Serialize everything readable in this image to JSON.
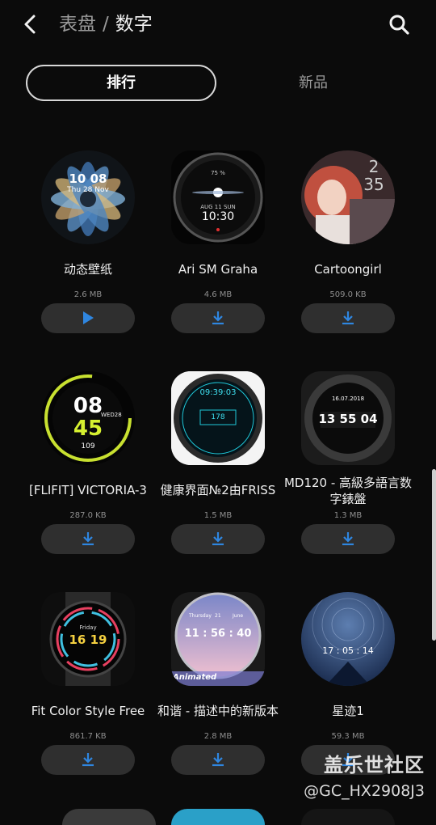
{
  "header": {
    "crumb": "表盘",
    "separator": "/",
    "current": "数字"
  },
  "tabs": [
    {
      "label": "排行",
      "active": true
    },
    {
      "label": "新品",
      "active": false
    }
  ],
  "cards": [
    {
      "name": "动态壁纸",
      "size": "2.6 MB",
      "action": "play",
      "face_text": [
        "10 08",
        "Thu 28 Nov"
      ]
    },
    {
      "name": "Ari SM Graha",
      "size": "4.6 MB",
      "action": "download",
      "face_text": [
        "75 %",
        "AUG 11 SUN",
        "10:30"
      ]
    },
    {
      "name": "Cartoongirl",
      "size": "509.0 KB",
      "action": "download",
      "face_text": [
        "2",
        "35"
      ]
    },
    {
      "name": "[FLIFIT] VICTORIA-3",
      "size": "287.0 KB",
      "action": "download",
      "face_text": [
        "08",
        "45",
        "WED28",
        "109"
      ]
    },
    {
      "name": "健康界面№2由FRISS",
      "size": "1.5 MB",
      "action": "download",
      "face_text": [
        "09:39:03",
        "178"
      ]
    },
    {
      "name": "MD120 - 高級多語言数字錶盤",
      "size": "1.3 MB",
      "action": "download",
      "face_text": [
        "16.07.2018",
        "13 55 04"
      ]
    },
    {
      "name": "Fit Color Style Free",
      "size": "861.7 KB",
      "action": "download",
      "face_text": [
        "Friday",
        "16 19"
      ]
    },
    {
      "name": "和谐 - 描述中的新版本",
      "size": "2.8 MB",
      "action": "download",
      "face_text": [
        "Thursday",
        "21",
        "June",
        "11 : 56 : 40",
        "Animated"
      ]
    },
    {
      "name": "星迹1",
      "size": "59.3 MB",
      "action": "download",
      "face_text": [
        "17 : 05 : 14"
      ]
    }
  ],
  "watermark": {
    "line1": "盖乐世社区",
    "line2": "@GC_HX2908J3"
  },
  "colors": {
    "background": "#0b0b0b",
    "accent": "#2f86e0",
    "button_bg": "#2f2f2f"
  }
}
